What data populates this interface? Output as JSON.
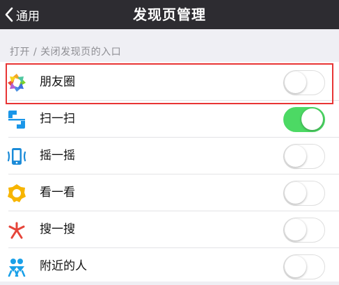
{
  "navbar": {
    "back_label": "通用",
    "title": "发现页管理"
  },
  "section": {
    "header": "打开 / 关闭发现页的入口"
  },
  "items": [
    {
      "label": "朋友圈",
      "icon": "moments-icon",
      "enabled": false,
      "highlighted": true
    },
    {
      "label": "扫一扫",
      "icon": "scan-icon",
      "enabled": true
    },
    {
      "label": "摇一摇",
      "icon": "shake-icon",
      "enabled": false
    },
    {
      "label": "看一看",
      "icon": "top-stories-icon",
      "enabled": false
    },
    {
      "label": "搜一搜",
      "icon": "search-icon",
      "enabled": false
    },
    {
      "label": "附近的人",
      "icon": "people-nearby-icon",
      "enabled": false
    }
  ],
  "colors": {
    "navbar_bg": "#2d2c31",
    "toggle_on": "#4cd964",
    "highlight": "#e83434",
    "scan_blue": "#1a96e8",
    "shake_blue": "#1b8bd8",
    "stories_yellow": "#f7b500",
    "search_red": "#e6453a",
    "nearby_blue": "#1aa0e8"
  }
}
